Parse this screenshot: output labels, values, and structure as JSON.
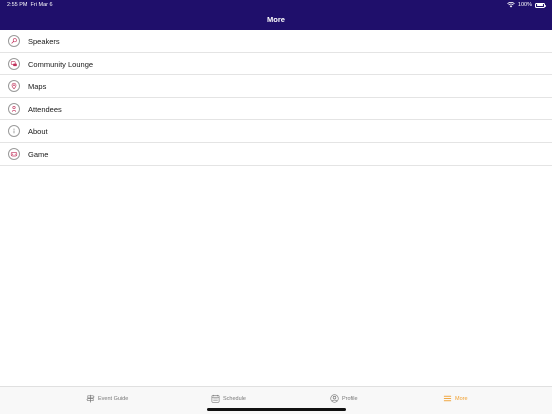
{
  "status_bar": {
    "time": "2:55 PM",
    "date": "Fri Mar 6",
    "battery": "100%"
  },
  "header": {
    "title": "More",
    "background": "#1f0f6b"
  },
  "menu": [
    {
      "label": "Speakers",
      "icon": "microphone-icon"
    },
    {
      "label": "Community Lounge",
      "icon": "chat-icon"
    },
    {
      "label": "Maps",
      "icon": "map-icon"
    },
    {
      "label": "Attendees",
      "icon": "attendees-icon"
    },
    {
      "label": "About",
      "icon": "info-icon"
    },
    {
      "label": "Game",
      "icon": "game-icon"
    }
  ],
  "tabbar": {
    "tabs": [
      {
        "label": "Event Guide",
        "icon": "event-guide-icon",
        "active": false
      },
      {
        "label": "Schedule",
        "icon": "calendar-icon",
        "active": false
      },
      {
        "label": "Profile",
        "icon": "profile-icon",
        "active": false
      },
      {
        "label": "More",
        "icon": "menu-icon",
        "active": true
      }
    ],
    "active_color": "#f0a030"
  },
  "accent_icon_color": "#c0305a"
}
